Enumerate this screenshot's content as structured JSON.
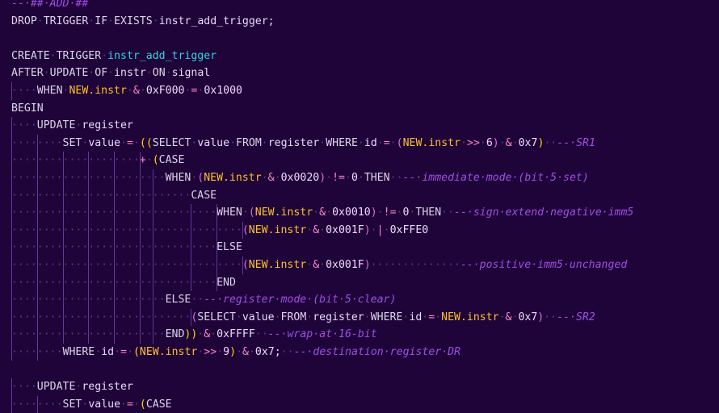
{
  "editor": {
    "language": "sql",
    "colors": {
      "background": "#1e0438",
      "keyword": "#ddd3ea",
      "comment": "#a24de8",
      "operator": "#ff82c9",
      "new_ref": "#ffbf2e",
      "trigger_name": "#33d1e6",
      "paren": "#ffd700",
      "whitespace_dot": "#5b3b86",
      "indent_guide": "#6e3fb3"
    },
    "lines": [
      {
        "guides": [],
        "tokens": [
          {
            "c": "comment",
            "t": "--·##·ADD·##"
          }
        ]
      },
      {
        "guides": [],
        "tokens": [
          {
            "c": "kw",
            "t": "DROP"
          },
          {
            "c": "ws",
            "t": "·"
          },
          {
            "c": "kw",
            "t": "TRIGGER"
          },
          {
            "c": "ws",
            "t": "·"
          },
          {
            "c": "kw",
            "t": "IF"
          },
          {
            "c": "ws",
            "t": "·"
          },
          {
            "c": "kw",
            "t": "EXISTS"
          },
          {
            "c": "ws",
            "t": "·"
          },
          {
            "c": "id",
            "t": "instr_add_trigger"
          },
          {
            "c": "plain",
            "t": ";"
          }
        ]
      },
      {
        "guides": [],
        "tokens": []
      },
      {
        "guides": [],
        "tokens": [
          {
            "c": "kw",
            "t": "CREATE"
          },
          {
            "c": "ws",
            "t": "·"
          },
          {
            "c": "kw",
            "t": "TRIGGER"
          },
          {
            "c": "ws",
            "t": "·"
          },
          {
            "c": "fn",
            "t": "instr_add_trigger"
          }
        ]
      },
      {
        "guides": [],
        "tokens": [
          {
            "c": "kw",
            "t": "AFTER"
          },
          {
            "c": "ws",
            "t": "·"
          },
          {
            "c": "kw",
            "t": "UPDATE"
          },
          {
            "c": "ws",
            "t": "·"
          },
          {
            "c": "kw",
            "t": "OF"
          },
          {
            "c": "ws",
            "t": "·"
          },
          {
            "c": "id",
            "t": "instr"
          },
          {
            "c": "ws",
            "t": "·"
          },
          {
            "c": "kw",
            "t": "ON"
          },
          {
            "c": "ws",
            "t": "·"
          },
          {
            "c": "id",
            "t": "signal"
          }
        ]
      },
      {
        "guides": [
          0
        ],
        "tokens": [
          {
            "c": "ws",
            "t": "····"
          },
          {
            "c": "kw",
            "t": "WHEN"
          },
          {
            "c": "ws",
            "t": "·"
          },
          {
            "c": "new",
            "t": "NEW.instr"
          },
          {
            "c": "ws",
            "t": "·"
          },
          {
            "c": "op",
            "t": "&"
          },
          {
            "c": "ws",
            "t": "·"
          },
          {
            "c": "num",
            "t": "0xF000"
          },
          {
            "c": "ws",
            "t": "·"
          },
          {
            "c": "op",
            "t": "="
          },
          {
            "c": "ws",
            "t": "·"
          },
          {
            "c": "num",
            "t": "0x1000"
          }
        ]
      },
      {
        "guides": [],
        "tokens": [
          {
            "c": "kw",
            "t": "BEGIN"
          }
        ]
      },
      {
        "guides": [
          0
        ],
        "tokens": [
          {
            "c": "ws",
            "t": "····"
          },
          {
            "c": "kw",
            "t": "UPDATE"
          },
          {
            "c": "ws",
            "t": "·"
          },
          {
            "c": "id",
            "t": "register"
          }
        ]
      },
      {
        "guides": [
          0,
          4
        ],
        "tokens": [
          {
            "c": "ws",
            "t": "········"
          },
          {
            "c": "kw",
            "t": "SET"
          },
          {
            "c": "ws",
            "t": "·"
          },
          {
            "c": "id",
            "t": "value"
          },
          {
            "c": "ws",
            "t": "·"
          },
          {
            "c": "op",
            "t": "="
          },
          {
            "c": "ws",
            "t": "·"
          },
          {
            "c": "paren",
            "t": "(("
          },
          {
            "c": "kw",
            "t": "SELECT"
          },
          {
            "c": "ws",
            "t": "·"
          },
          {
            "c": "id",
            "t": "value"
          },
          {
            "c": "ws",
            "t": "·"
          },
          {
            "c": "kw",
            "t": "FROM"
          },
          {
            "c": "ws",
            "t": "·"
          },
          {
            "c": "id",
            "t": "register"
          },
          {
            "c": "ws",
            "t": "·"
          },
          {
            "c": "kw",
            "t": "WHERE"
          },
          {
            "c": "ws",
            "t": "·"
          },
          {
            "c": "id",
            "t": "id"
          },
          {
            "c": "ws",
            "t": "·"
          },
          {
            "c": "op",
            "t": "="
          },
          {
            "c": "ws",
            "t": "·"
          },
          {
            "c": "paren2",
            "t": "("
          },
          {
            "c": "new",
            "t": "NEW.instr"
          },
          {
            "c": "ws",
            "t": "·"
          },
          {
            "c": "op",
            "t": ">>"
          },
          {
            "c": "ws",
            "t": "·"
          },
          {
            "c": "num",
            "t": "6"
          },
          {
            "c": "paren2",
            "t": ")"
          },
          {
            "c": "ws",
            "t": "·"
          },
          {
            "c": "op",
            "t": "&"
          },
          {
            "c": "ws",
            "t": "·"
          },
          {
            "c": "num",
            "t": "0x7"
          },
          {
            "c": "paren",
            "t": ")"
          },
          {
            "c": "ws",
            "t": "··"
          },
          {
            "c": "comment",
            "t": "--·SR1"
          }
        ]
      },
      {
        "guides": [
          0,
          4,
          8,
          12,
          16,
          20
        ],
        "tokens": [
          {
            "c": "ws",
            "t": "····················"
          },
          {
            "c": "op",
            "t": "+"
          },
          {
            "c": "ws",
            "t": "·"
          },
          {
            "c": "paren",
            "t": "("
          },
          {
            "c": "kw",
            "t": "CASE"
          }
        ]
      },
      {
        "guides": [
          0,
          4,
          8,
          12,
          16,
          20,
          22
        ],
        "tokens": [
          {
            "c": "ws",
            "t": "························"
          },
          {
            "c": "kw",
            "t": "WHEN"
          },
          {
            "c": "ws",
            "t": "·"
          },
          {
            "c": "paren2",
            "t": "("
          },
          {
            "c": "new",
            "t": "NEW.instr"
          },
          {
            "c": "ws",
            "t": "·"
          },
          {
            "c": "op",
            "t": "&"
          },
          {
            "c": "ws",
            "t": "·"
          },
          {
            "c": "num",
            "t": "0x0020"
          },
          {
            "c": "paren2",
            "t": ")"
          },
          {
            "c": "ws",
            "t": "·"
          },
          {
            "c": "op",
            "t": "!="
          },
          {
            "c": "ws",
            "t": "·"
          },
          {
            "c": "num",
            "t": "0"
          },
          {
            "c": "ws",
            "t": "·"
          },
          {
            "c": "kw",
            "t": "THEN"
          },
          {
            "c": "ws",
            "t": "··"
          },
          {
            "c": "comment",
            "t": "--·immediate·mode·(bit·5·set)"
          }
        ]
      },
      {
        "guides": [
          0,
          4,
          8,
          12,
          16,
          20,
          22
        ],
        "tokens": [
          {
            "c": "ws",
            "t": "····························"
          },
          {
            "c": "kw",
            "t": "CASE"
          }
        ]
      },
      {
        "guides": [
          0,
          4,
          8,
          12,
          16,
          20,
          22,
          28,
          32
        ],
        "tokens": [
          {
            "c": "ws",
            "t": "································"
          },
          {
            "c": "kw",
            "t": "WHEN"
          },
          {
            "c": "ws",
            "t": "·"
          },
          {
            "c": "paren2",
            "t": "("
          },
          {
            "c": "new",
            "t": "NEW.instr"
          },
          {
            "c": "ws",
            "t": "·"
          },
          {
            "c": "op",
            "t": "&"
          },
          {
            "c": "ws",
            "t": "·"
          },
          {
            "c": "num",
            "t": "0x0010"
          },
          {
            "c": "paren2",
            "t": ")"
          },
          {
            "c": "ws",
            "t": "·"
          },
          {
            "c": "op",
            "t": "!="
          },
          {
            "c": "ws",
            "t": "·"
          },
          {
            "c": "num",
            "t": "0"
          },
          {
            "c": "ws",
            "t": "·"
          },
          {
            "c": "kw",
            "t": "THEN"
          },
          {
            "c": "ws",
            "t": "··"
          },
          {
            "c": "comment",
            "t": "--·sign·extend·negative·imm5"
          }
        ]
      },
      {
        "guides": [
          0,
          4,
          8,
          12,
          16,
          20,
          22,
          28,
          32,
          36
        ],
        "tokens": [
          {
            "c": "ws",
            "t": "····································"
          },
          {
            "c": "paren2",
            "t": "("
          },
          {
            "c": "new",
            "t": "NEW.instr"
          },
          {
            "c": "ws",
            "t": "·"
          },
          {
            "c": "op",
            "t": "&"
          },
          {
            "c": "ws",
            "t": "·"
          },
          {
            "c": "num",
            "t": "0x001F"
          },
          {
            "c": "paren2",
            "t": ")"
          },
          {
            "c": "ws",
            "t": "·"
          },
          {
            "c": "op",
            "t": "|"
          },
          {
            "c": "ws",
            "t": "·"
          },
          {
            "c": "num",
            "t": "0xFFE0"
          }
        ]
      },
      {
        "guides": [
          0,
          4,
          8,
          12,
          16,
          20,
          22,
          28,
          32
        ],
        "tokens": [
          {
            "c": "ws",
            "t": "································"
          },
          {
            "c": "kw",
            "t": "ELSE"
          }
        ]
      },
      {
        "guides": [
          0,
          4,
          8,
          12,
          16,
          20,
          22,
          28,
          32,
          36
        ],
        "tokens": [
          {
            "c": "ws",
            "t": "····································"
          },
          {
            "c": "paren2",
            "t": "("
          },
          {
            "c": "new",
            "t": "NEW.instr"
          },
          {
            "c": "ws",
            "t": "·"
          },
          {
            "c": "op",
            "t": "&"
          },
          {
            "c": "ws",
            "t": "·"
          },
          {
            "c": "num",
            "t": "0x001F"
          },
          {
            "c": "paren2",
            "t": ")"
          },
          {
            "c": "ws",
            "t": "··············"
          },
          {
            "c": "comment",
            "t": "--·positive·imm5·unchanged"
          }
        ]
      },
      {
        "guides": [
          0,
          4,
          8,
          12,
          16,
          20,
          22,
          28,
          32
        ],
        "tokens": [
          {
            "c": "ws",
            "t": "································"
          },
          {
            "c": "kw",
            "t": "END"
          }
        ]
      },
      {
        "guides": [
          0,
          4,
          8,
          12,
          16,
          20,
          22
        ],
        "tokens": [
          {
            "c": "ws",
            "t": "························"
          },
          {
            "c": "kw",
            "t": "ELSE"
          },
          {
            "c": "ws",
            "t": "··"
          },
          {
            "c": "comment",
            "t": "--·register·mode·(bit·5·clear)"
          }
        ]
      },
      {
        "guides": [
          0,
          4,
          8,
          12,
          16,
          20,
          22,
          28
        ],
        "tokens": [
          {
            "c": "ws",
            "t": "····························"
          },
          {
            "c": "paren2",
            "t": "("
          },
          {
            "c": "kw",
            "t": "SELECT"
          },
          {
            "c": "ws",
            "t": "·"
          },
          {
            "c": "id",
            "t": "value"
          },
          {
            "c": "ws",
            "t": "·"
          },
          {
            "c": "kw",
            "t": "FROM"
          },
          {
            "c": "ws",
            "t": "·"
          },
          {
            "c": "id",
            "t": "register"
          },
          {
            "c": "ws",
            "t": "·"
          },
          {
            "c": "kw",
            "t": "WHERE"
          },
          {
            "c": "ws",
            "t": "·"
          },
          {
            "c": "id",
            "t": "id"
          },
          {
            "c": "ws",
            "t": "·"
          },
          {
            "c": "op",
            "t": "="
          },
          {
            "c": "ws",
            "t": "·"
          },
          {
            "c": "new",
            "t": "NEW.instr"
          },
          {
            "c": "ws",
            "t": "·"
          },
          {
            "c": "op",
            "t": "&"
          },
          {
            "c": "ws",
            "t": "·"
          },
          {
            "c": "num",
            "t": "0x7"
          },
          {
            "c": "paren2",
            "t": ")"
          },
          {
            "c": "ws",
            "t": "··"
          },
          {
            "c": "comment",
            "t": "--·SR2"
          }
        ]
      },
      {
        "guides": [
          0,
          4,
          8,
          12,
          16,
          20,
          22
        ],
        "tokens": [
          {
            "c": "ws",
            "t": "························"
          },
          {
            "c": "kw",
            "t": "END"
          },
          {
            "c": "paren",
            "t": "))"
          },
          {
            "c": "ws",
            "t": "·"
          },
          {
            "c": "op",
            "t": "&"
          },
          {
            "c": "ws",
            "t": "·"
          },
          {
            "c": "num",
            "t": "0xFFFF"
          },
          {
            "c": "ws",
            "t": "··"
          },
          {
            "c": "comment",
            "t": "--·wrap·at·16-bit"
          }
        ]
      },
      {
        "guides": [
          0,
          4
        ],
        "tokens": [
          {
            "c": "ws",
            "t": "········"
          },
          {
            "c": "kw",
            "t": "WHERE"
          },
          {
            "c": "ws",
            "t": "·"
          },
          {
            "c": "id",
            "t": "id"
          },
          {
            "c": "ws",
            "t": "·"
          },
          {
            "c": "op",
            "t": "="
          },
          {
            "c": "ws",
            "t": "·"
          },
          {
            "c": "paren",
            "t": "("
          },
          {
            "c": "new",
            "t": "NEW.instr"
          },
          {
            "c": "ws",
            "t": "·"
          },
          {
            "c": "op",
            "t": ">>"
          },
          {
            "c": "ws",
            "t": "·"
          },
          {
            "c": "num",
            "t": "9"
          },
          {
            "c": "paren",
            "t": ")"
          },
          {
            "c": "ws",
            "t": "·"
          },
          {
            "c": "op",
            "t": "&"
          },
          {
            "c": "ws",
            "t": "·"
          },
          {
            "c": "num",
            "t": "0x7"
          },
          {
            "c": "plain",
            "t": ";"
          },
          {
            "c": "ws",
            "t": "··"
          },
          {
            "c": "comment",
            "t": "--·destination·register·DR"
          }
        ]
      },
      {
        "guides": [],
        "tokens": []
      },
      {
        "guides": [
          0
        ],
        "tokens": [
          {
            "c": "ws",
            "t": "····"
          },
          {
            "c": "kw",
            "t": "UPDATE"
          },
          {
            "c": "ws",
            "t": "·"
          },
          {
            "c": "id",
            "t": "register"
          }
        ]
      },
      {
        "guides": [
          0,
          4
        ],
        "tokens": [
          {
            "c": "ws",
            "t": "········"
          },
          {
            "c": "kw",
            "t": "SET"
          },
          {
            "c": "ws",
            "t": "·"
          },
          {
            "c": "id",
            "t": "value"
          },
          {
            "c": "ws",
            "t": "·"
          },
          {
            "c": "op",
            "t": "="
          },
          {
            "c": "ws",
            "t": "·"
          },
          {
            "c": "paren",
            "t": "("
          },
          {
            "c": "kw",
            "t": "CASE"
          }
        ]
      }
    ]
  }
}
